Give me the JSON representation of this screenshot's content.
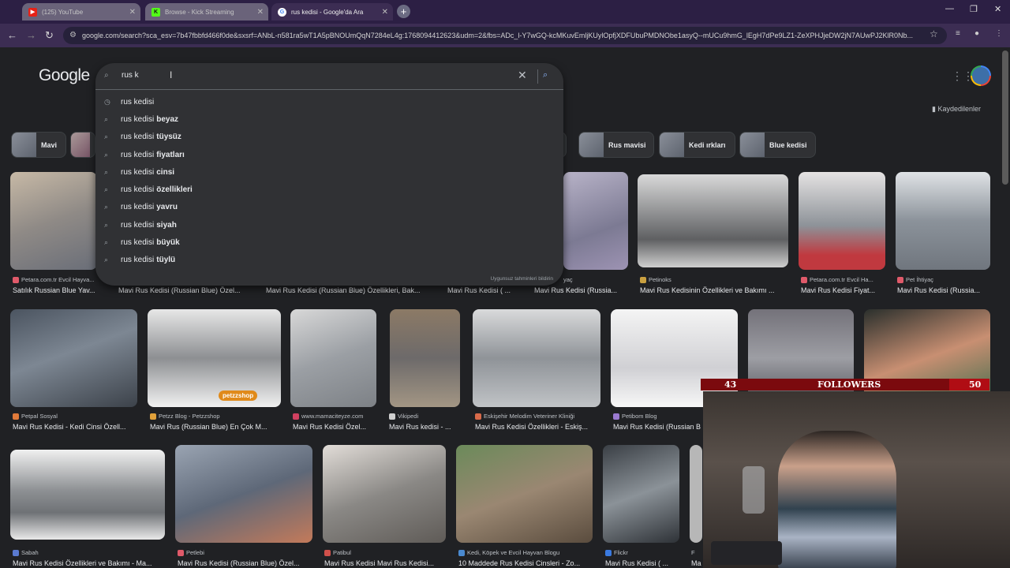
{
  "tabs": [
    {
      "label": "(125) YouTube",
      "icon": "youtube-icon",
      "color": "#e62117"
    },
    {
      "label": "Browse - Kick Streaming",
      "icon": "kick-icon",
      "color": "#53fc18"
    },
    {
      "label": "rus kedisi - Google'da Ara",
      "icon": "google-icon",
      "color": "#ffffff"
    }
  ],
  "url": "google.com/search?sca_esv=7b47fbbfd466f0de&sxsrf=ANbL-n581ra5wT1A5pBNOUmQqN7284eL4g:1768094412623&udm=2&fbs=ADc_l-Y7wGQ-kcMKuvEmljKUylOpfjXDFUbuPMDNObe1asyQ--mUCu9hmG_lEgH7dPe9LZ1-ZeXPHJjeDW2jN7AUwPJ2KlR0Nb...",
  "google": {
    "logo": "Google",
    "saved_label": "Kaydedilenler"
  },
  "search": {
    "value": "rus k",
    "suggestions": [
      {
        "prefix": "rus kedisi",
        "bold": "",
        "icon": "history-icon"
      },
      {
        "prefix": "rus kedisi",
        "bold": "beyaz",
        "icon": "search-icon"
      },
      {
        "prefix": "rus kedisi",
        "bold": "tüysüz",
        "icon": "search-icon"
      },
      {
        "prefix": "rus kedisi",
        "bold": "fiyatları",
        "icon": "search-icon"
      },
      {
        "prefix": "rus kedisi",
        "bold": "cinsi",
        "icon": "search-icon"
      },
      {
        "prefix": "rus kedisi",
        "bold": "özellikleri",
        "icon": "search-icon"
      },
      {
        "prefix": "rus kedisi",
        "bold": "yavru",
        "icon": "search-icon"
      },
      {
        "prefix": "rus kedisi",
        "bold": "siyah",
        "icon": "search-icon"
      },
      {
        "prefix": "rus kedisi",
        "bold": "büyük",
        "icon": "search-icon"
      },
      {
        "prefix": "rus kedisi",
        "bold": "tüylü",
        "icon": "search-icon"
      }
    ],
    "report_label": "Uygunsuz tahminleri bildirin"
  },
  "chips": [
    "Mavi",
    "",
    "r",
    "Rus mavisi",
    "Kedi ırkları",
    "Blue kedisi"
  ],
  "results": [
    {
      "source": "Petara.com.tr Evcil Hayva...",
      "title": "Satılık Russian Blue Yav..."
    },
    {
      "source": "",
      "title": "Mavi Rus Kedisi (Russian Blue) Özel..."
    },
    {
      "source": "",
      "title": "Mavi Rus Kedisi (Russian Blue) Özellikleri, Bak..."
    },
    {
      "source": "",
      "title": "Mavi Rus Kedisi ( ..."
    },
    {
      "source": "yaç",
      "title": "Mavi Rus Kedisi (Russia..."
    },
    {
      "source": "Petinoks",
      "title": "Mavi Rus Kedisinin Özellikleri ve Bakımı ..."
    },
    {
      "source": "Petara.com.tr Evcil Ha...",
      "title": "Mavi Rus Kedisi Fiyat..."
    },
    {
      "source": "Pet İhtiyaç",
      "title": "Mavi Rus Kedisi (Russia..."
    },
    {
      "source": "Petpal Sosyal",
      "title": "Mavi Rus Kedisi - Kedi Cinsi Özell..."
    },
    {
      "source": "Petzz Blog - Petzzshop",
      "title": "Mavi Rus (Russian Blue) En Çok M..."
    },
    {
      "source": "www.mamaciteyze.com",
      "title": "Mavi Rus Kedisi Özel..."
    },
    {
      "source": "Vikipedi",
      "title": "Mavi Rus kedisi - ..."
    },
    {
      "source": "Eskişehir Melodim Veteriner Kliniği",
      "title": "Mavi Rus Kedisi Özellikleri - Eskiş..."
    },
    {
      "source": "Petibom Blog",
      "title": "Mavi Rus Kedisi (Russian B"
    },
    {
      "source": "Sabah",
      "title": "Mavi Rus Kedisi Özellikleri ve Bakımı - Ma..."
    },
    {
      "source": "Petlebi",
      "title": "Mavi Rus Kedisi (Russian Blue) Özel..."
    },
    {
      "source": "Patibul",
      "title": "Mavi Rus Kedisi Mavi Rus Kedisi..."
    },
    {
      "source": "Kedi, Köpek ve Evcil Hayvan Blogu",
      "title": "10 Maddede Rus Kedisi Cinsleri - Zo..."
    },
    {
      "source": "Flickr",
      "title": "Mavi Rus Kedisi ( ..."
    },
    {
      "source": "F",
      "title": "Ma"
    }
  ],
  "overlay": {
    "current": "43",
    "label": "FOLLOWERS",
    "goal": "50",
    "progress": 0.86
  },
  "watermarks": {
    "petzz": "petzzshop"
  }
}
